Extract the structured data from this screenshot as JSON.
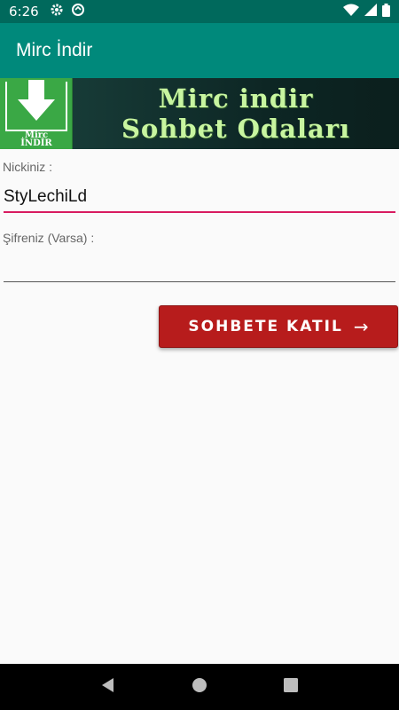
{
  "status_bar": {
    "time": "6:26",
    "icons": [
      "gear-icon",
      "data-saver-icon",
      "wifi-icon",
      "signal-icon",
      "battery-icon"
    ]
  },
  "app_bar": {
    "title": "Mirc İndir"
  },
  "banner": {
    "logo_text_line1": "Mirc",
    "logo_text_line2": "İNDİR",
    "headline_line1": "Mirc indir",
    "headline_line2": "Sohbet Odaları"
  },
  "form": {
    "nick_label": "Nickiniz :",
    "nick_value": "StyLechiLd",
    "password_label": "Şifreniz (Varsa) :",
    "password_value": ""
  },
  "join_button": {
    "label": "SOHBETE KATIL",
    "arrow": "→"
  },
  "nav_bar": {
    "icons": [
      "back-icon",
      "home-icon",
      "recents-icon"
    ]
  },
  "colors": {
    "status_bar": "#00695c",
    "app_bar": "#00897b",
    "accent": "#d81b60",
    "button": "#b71c1c",
    "banner_text": "#c8f5a0",
    "logo_green": "#3aa845"
  }
}
